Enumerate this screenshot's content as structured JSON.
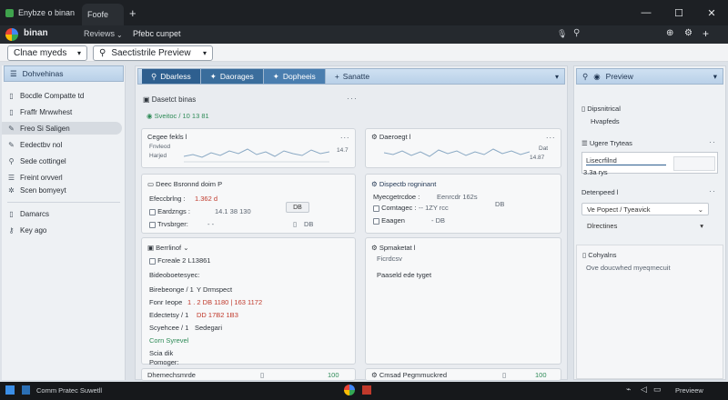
{
  "browser": {
    "tabs": [
      {
        "label": "Enybze o binan",
        "active": false
      },
      {
        "label": "Foofe",
        "active": true
      }
    ],
    "new_tab": "+",
    "minimize": "—",
    "maximize": "☐",
    "close": "✕",
    "address_app": "binan",
    "address_nav": "Reviews",
    "address_title": "Pfebc cunpet",
    "extensions": [
      "🎙",
      "⚲"
    ],
    "right_icons": [
      "⊕",
      "⚙",
      "+"
    ]
  },
  "toolbar": {
    "workspace_select": "Clnae myeds",
    "view_select": "Saectistrile Preview"
  },
  "sidebar": {
    "header": "Dohvehinas",
    "items": [
      {
        "icon": "page-icon",
        "label": "Bocdle Compatte td"
      },
      {
        "icon": "document-icon",
        "label": "Fraffr Mrwwhest"
      },
      {
        "icon": "pen-icon",
        "label": "Freo Si Saligen"
      },
      {
        "icon": "pen-icon",
        "label": "Eedectbv nol"
      },
      {
        "icon": "search-icon",
        "label": "Sede cottingel"
      },
      {
        "icon": "list-icon",
        "label": "Freint orvverl"
      },
      {
        "icon": "gear-icon",
        "label": "Scen bomyeyt"
      },
      {
        "icon": "clipboard-icon",
        "label": "Damarcs"
      },
      {
        "icon": "key-icon",
        "label": "Key ago"
      }
    ]
  },
  "center": {
    "tabs": [
      "Dbarless",
      "Daorages",
      "Dopheeis",
      "Sanatte"
    ],
    "section_title": "Dasetct binas",
    "section_status": "Sveitoc / 10 13 81",
    "cards": {
      "chart1": {
        "title": "Cegee fekls l",
        "legend1": "Fnvleod",
        "legend2": "Harjed",
        "value": "14.7",
        "menu": "..."
      },
      "chart2": {
        "title": "Daeroegt l",
        "legend1": "Dat",
        "legend2": "Dat",
        "value": "14.87",
        "menu": "..."
      },
      "table1": {
        "title": "Deec Bsronnd doim P",
        "rows": [
          {
            "label": "Efeccbrlng :",
            "value": "1.362 d",
            "extra": ""
          },
          {
            "label": "Eardzngs :",
            "value": "14.1 38 130",
            "extra": "DB"
          },
          {
            "label": "Trvsbrger:",
            "value": "- -",
            "extra": "DB"
          }
        ]
      },
      "table2": {
        "title": "Dispectb rogninant",
        "rows": [
          {
            "label": "Myecgetrcdoe :",
            "value": "Eenrcdr 162s",
            "extra": "DB"
          },
          {
            "label": "Comtagec :",
            "value": "-- 1ZY rcc",
            "extra": ""
          },
          {
            "label": "Eaagen",
            "value": "- DB",
            "extra": ""
          }
        ]
      },
      "detail1": {
        "title": "Berrlinof",
        "subtitle": "Fcreale 2 L13861",
        "lines": [
          {
            "label": "Bideoboetesyec:",
            "value": ""
          },
          {
            "label": "Birebeonge / 1",
            "value": "Y Drmspect"
          },
          {
            "label": "Fonr Ieope",
            "value": "1 . 2 DB 1180 | 163 1172"
          },
          {
            "label": "Edectetsy / 1",
            "value": "DD 17B2 1B3"
          },
          {
            "label": "Scyehcee / 1",
            "value": "Sedegari"
          },
          {
            "label": "Corn Syrevel",
            "value": ""
          },
          {
            "label": "Scia dik",
            "value": ""
          },
          {
            "label": "Pomoger:",
            "value": ""
          }
        ]
      },
      "detail2": {
        "title": "Spmaketat l",
        "subtitle": "Ficrdcsv",
        "line": "Paaseld ede tyget"
      },
      "footer1": {
        "label": "Dhemechsmrde",
        "value": "100"
      },
      "footer2": {
        "label": "Cmsad Pegmmuckred",
        "value": "100"
      }
    }
  },
  "right": {
    "header": "Preview",
    "summary_title": "Dipsnitrical",
    "summary_sub": "Hvapfeds",
    "group1_title": "Ugere Tryteas",
    "group1_input": "Lisecrfilnd",
    "group1_value": "3.3a rys",
    "group2_title": "Detenpeed l",
    "group2_select": "Ve Popect / Tyeavick",
    "group2_select2": "Dlrectines",
    "group3_title": "Cohyalns",
    "group3_text": "Ove doucwhed myeqmecuit"
  },
  "taskbar": {
    "start_label": "Comm Pratec Suwetll",
    "tray_text": "Previeew"
  },
  "colors": {
    "accent_header": "#b9d0e8",
    "tab_bg": "#1d2024",
    "toolbar_bg": "#f2f3f5",
    "green": "#2e8b57",
    "red": "#c0392b"
  }
}
